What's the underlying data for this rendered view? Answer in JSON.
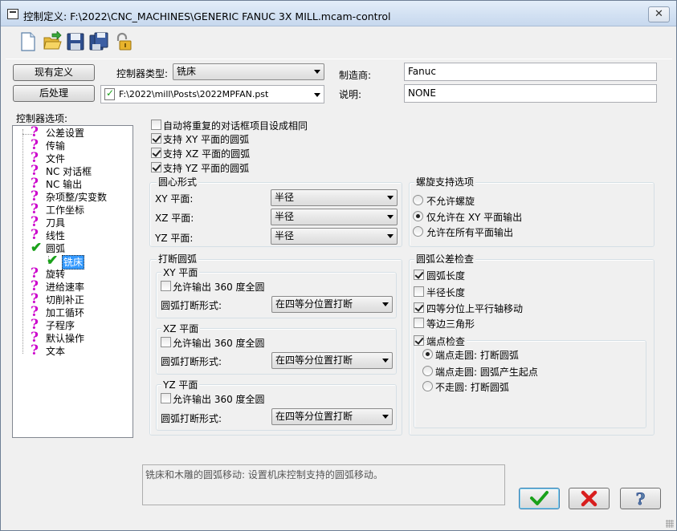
{
  "window": {
    "title": "控制定义: F:\\2022\\CNC_MACHINES\\GENERIC FANUC 3X MILL.mcam-control",
    "close_label": "✕"
  },
  "toolbar": {
    "icons": [
      "new-file-icon",
      "open-folder-icon",
      "save-icon",
      "save-all-icon",
      "lock-icon"
    ]
  },
  "header": {
    "current_def_button": "现有定义",
    "post_button": "后处理",
    "controller_type_label": "控制器类型:",
    "controller_type_value": "铣床",
    "post_path": "F:\\2022\\mill\\Posts\\2022MPFAN.pst",
    "manufacturer_label": "制造商:",
    "manufacturer_value": "Fanuc",
    "description_label": "说明:",
    "description_value": "NONE"
  },
  "tree": {
    "label": "控制器选项:",
    "items": [
      "公差设置",
      "传输",
      "文件",
      "NC 对话框",
      "NC 输出",
      "杂项整/实变数",
      "工作坐标",
      "刀具",
      "线性",
      "圆弧",
      "铣床",
      "旋转",
      "进给速率",
      "切削补正",
      "加工循环",
      "子程序",
      "默认操作",
      "文本"
    ],
    "selected": "铣床"
  },
  "options": {
    "auto_same": "自动将重复的对话框项目设成相同",
    "xy_arc": "支持 XY 平面的圆弧",
    "xz_arc": "支持 XZ 平面的圆弧",
    "yz_arc": "支持 YZ 平面的圆弧"
  },
  "center_format": {
    "title": "圆心形式",
    "xy_label": "XY 平面:",
    "xz_label": "XZ 平面:",
    "yz_label": "YZ 平面:",
    "xy_value": "半径",
    "xz_value": "半径",
    "yz_value": "半径"
  },
  "helix": {
    "title": "螺旋支持选项",
    "opt1": "不允许螺旋",
    "opt2": "仅允许在 XY 平面输出",
    "opt3": "允许在所有平面输出",
    "selected": "仅允许在 XY 平面输出"
  },
  "break_arc": {
    "title": "打断圆弧",
    "xy_title": "XY 平面",
    "xz_title": "XZ 平面",
    "yz_title": "YZ 平面",
    "allow_360": "允许输出 360 度全圆",
    "break_type_label": "圆弧打断形式:",
    "break_type_value": "在四等分位置打断"
  },
  "tol_check": {
    "title": "圆弧公差检查",
    "arc_length": "圆弧长度",
    "radius_length": "半径长度",
    "quad_move": "四等分位上平行轴移动",
    "equilateral": "等边三角形",
    "endpoint_check": "端点检查",
    "ep1": "端点走圆: 打断圆弧",
    "ep2": "端点走圆: 圆弧产生起点",
    "ep3": "不走圆: 打断圆弧"
  },
  "footer": {
    "description": "铣床和木雕的圆弧移动: 设置机床控制支持的圆弧移动。"
  },
  "colors": {
    "ok_green": "#1aa11a",
    "cancel_red": "#d81e1e",
    "question_magenta": "#cc00cc"
  }
}
